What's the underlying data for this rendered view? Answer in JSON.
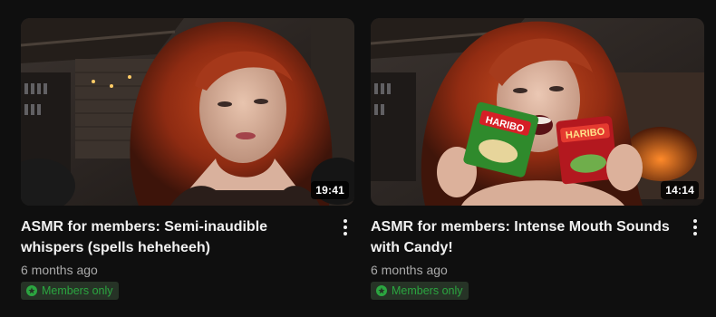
{
  "videos": [
    {
      "duration": "19:41",
      "title_line1": "ASMR for members: Semi-inaudible",
      "title_line2": "whispers (spells heheheeh)",
      "age": "6 months ago",
      "badge": "Members only"
    },
    {
      "duration": "14:14",
      "title_line1": "ASMR for members: Intense Mouth Sounds",
      "title_line2": "with Candy!",
      "age": "6 months ago",
      "badge": "Members only",
      "candy_label_1": "HARIBO",
      "candy_label_2": "HARIBO"
    }
  ],
  "colors": {
    "background": "#0f0f0f",
    "badge_text": "#2ba640",
    "badge_bg": "#263326",
    "secondary_text": "#aaaaaa"
  },
  "icons": {
    "more": "vertical-ellipsis-icon",
    "badge": "star-in-circle-icon"
  }
}
